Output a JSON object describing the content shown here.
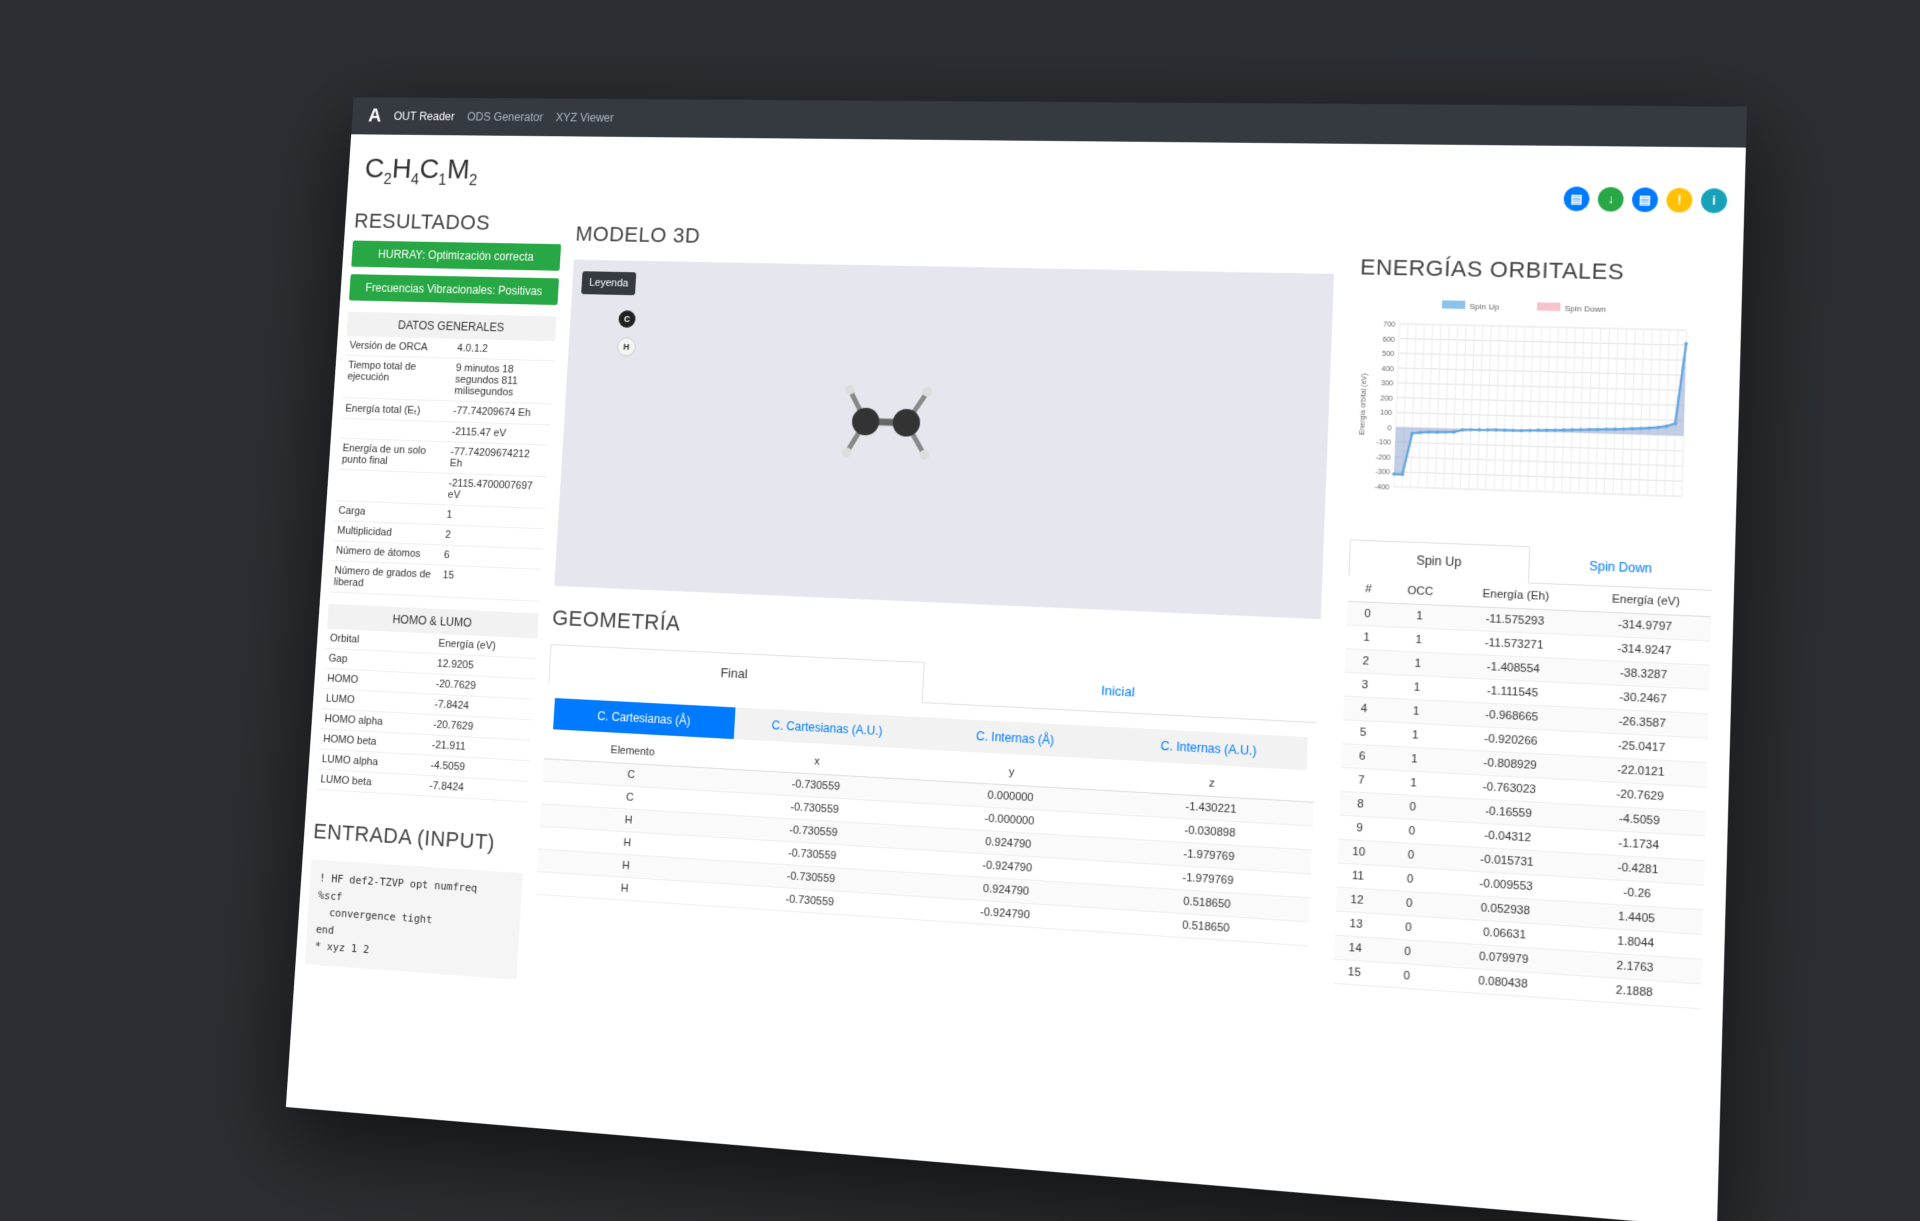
{
  "navbar": {
    "logo": "A",
    "links": [
      "OUT Reader",
      "ODS Generator",
      "XYZ Viewer"
    ]
  },
  "formula": {
    "parts": [
      [
        "C",
        "2"
      ],
      [
        "H",
        "4"
      ],
      [
        "C",
        "1"
      ],
      [
        "M",
        "2"
      ]
    ]
  },
  "left": {
    "title": "RESULTADOS",
    "alerts": [
      "HURRAY: Optimización correcta",
      "Frecuencias Vibracionales: Positivas"
    ],
    "general": {
      "header": "DATOS GENERALES",
      "rows": [
        [
          "Versión de ORCA",
          "4.0.1.2"
        ],
        [
          "Tiempo total de ejecución",
          "9 minutos 18 segundos 811 milisegundos"
        ],
        [
          "Energía total (Eₜ)",
          "-77.74209674 Eh"
        ],
        [
          "",
          "-2115.47 eV"
        ],
        [
          "Energía de un solo punto final",
          "-77.74209674212 Eh"
        ],
        [
          "",
          "-2115.4700007697 eV"
        ],
        [
          "Carga",
          "1"
        ],
        [
          "Multiplicidad",
          "2"
        ],
        [
          "Número de átomos",
          "6"
        ],
        [
          "Número de grados de liberad",
          "15"
        ]
      ]
    },
    "homolumo": {
      "header": "HOMO & LUMO",
      "col1": "Orbital",
      "col2": "Energía (eV)",
      "rows": [
        [
          "Gap",
          "12.9205"
        ],
        [
          "HOMO",
          "-20.7629"
        ],
        [
          "LUMO",
          "-7.8424"
        ],
        [
          "HOMO alpha",
          "-20.7629"
        ],
        [
          "HOMO beta",
          "-21.911"
        ],
        [
          "LUMO alpha",
          "-4.5059"
        ],
        [
          "LUMO beta",
          "-7.8424"
        ]
      ]
    },
    "input_title": "ENTRADA (INPUT)",
    "input_code": "! HF def2-TZVP opt numfreq\n%scf\n  convergence tight\nend\n* xyz 1 2"
  },
  "middle": {
    "model_title": "MODELO 3D",
    "legend_label": "Leyenda",
    "atoms": [
      "C",
      "H"
    ],
    "geometry_title": "GEOMETRÍA",
    "tabs": [
      "Final",
      "Inicial"
    ],
    "pills": [
      "C. Cartesianas (Å)",
      "C. Cartesianas (A.U.)",
      "C. Internas (Å)",
      "C. Internas (A.U.)"
    ],
    "columns": [
      "Elemento",
      "x",
      "y",
      "z"
    ],
    "rows": [
      [
        "C",
        "-0.730559",
        "0.000000",
        "-1.430221"
      ],
      [
        "C",
        "-0.730559",
        "-0.000000",
        "-0.030898"
      ],
      [
        "H",
        "-0.730559",
        "0.924790",
        "-1.979769"
      ],
      [
        "H",
        "-0.730559",
        "-0.924790",
        "-1.979769"
      ],
      [
        "H",
        "-0.730559",
        "0.924790",
        "0.518650"
      ],
      [
        "H",
        "-0.730559",
        "-0.924790",
        "0.518650"
      ]
    ]
  },
  "right": {
    "title": "ENERGÍAS ORBITALES",
    "icons": [
      {
        "name": "document-icon",
        "color": "#007bff",
        "glyph": "▤"
      },
      {
        "name": "download-icon",
        "color": "#28a745",
        "glyph": "↓"
      },
      {
        "name": "file-icon",
        "color": "#007bff",
        "glyph": "▤"
      },
      {
        "name": "warning-icon",
        "color": "#ffc107",
        "glyph": "!"
      },
      {
        "name": "info-icon",
        "color": "#17a2b8",
        "glyph": "i"
      }
    ],
    "spin_tabs": [
      "Spin Up",
      "Spin Down"
    ],
    "columns": [
      "#",
      "OCC",
      "Energía (Eh)",
      "Energía (eV)"
    ],
    "rows": [
      [
        "0",
        "1",
        "-11.575293",
        "-314.9797"
      ],
      [
        "1",
        "1",
        "-11.573271",
        "-314.9247"
      ],
      [
        "2",
        "1",
        "-1.408554",
        "-38.3287"
      ],
      [
        "3",
        "1",
        "-1.111545",
        "-30.2467"
      ],
      [
        "4",
        "1",
        "-0.968665",
        "-26.3587"
      ],
      [
        "5",
        "1",
        "-0.920266",
        "-25.0417"
      ],
      [
        "6",
        "1",
        "-0.808929",
        "-22.0121"
      ],
      [
        "7",
        "1",
        "-0.763023",
        "-20.7629"
      ],
      [
        "8",
        "0",
        "-0.16559",
        "-4.5059"
      ],
      [
        "9",
        "0",
        "-0.04312",
        "-1.1734"
      ],
      [
        "10",
        "0",
        "-0.015731",
        "-0.4281"
      ],
      [
        "11",
        "0",
        "-0.009553",
        "-0.26"
      ],
      [
        "12",
        "0",
        "0.052938",
        "1.4405"
      ],
      [
        "13",
        "0",
        "0.06631",
        "1.8044"
      ],
      [
        "14",
        "0",
        "0.079979",
        "2.1763"
      ],
      [
        "15",
        "0",
        "0.080438",
        "2.1888"
      ]
    ]
  },
  "chart_data": {
    "type": "area",
    "title": "",
    "xlabel": "",
    "ylabel": "Energía orbital (eV)",
    "ylim": [
      -400,
      700
    ],
    "yticks": [
      700,
      600,
      500,
      400,
      300,
      200,
      100,
      0,
      -100,
      -200,
      -300,
      -400
    ],
    "legend": "top",
    "grid": true,
    "series": [
      {
        "name": "Spin Up",
        "color": "#5aa9e6",
        "values": [
          -315,
          -315,
          -38,
          -30,
          -26,
          -25,
          -22,
          -21,
          -4.5,
          -1.2,
          -0.4,
          -0.3,
          1.4,
          1.8,
          2.2,
          2.2,
          5,
          8,
          10,
          12,
          15,
          18,
          20,
          22,
          25,
          28,
          30,
          33,
          36,
          40,
          45,
          50,
          60,
          80,
          610
        ]
      },
      {
        "name": "Spin Down",
        "color": "#f4a9b8",
        "values": [
          -315,
          -315,
          -38,
          -30,
          -26,
          -25,
          -22,
          -21,
          -4.5,
          -1.2,
          -0.4,
          -0.3,
          1.4,
          1.8,
          2.2,
          2.2,
          5,
          8,
          10,
          12,
          15,
          18,
          20,
          22,
          25,
          28,
          30,
          33,
          36,
          40,
          45,
          50,
          60,
          80,
          610
        ]
      }
    ]
  }
}
